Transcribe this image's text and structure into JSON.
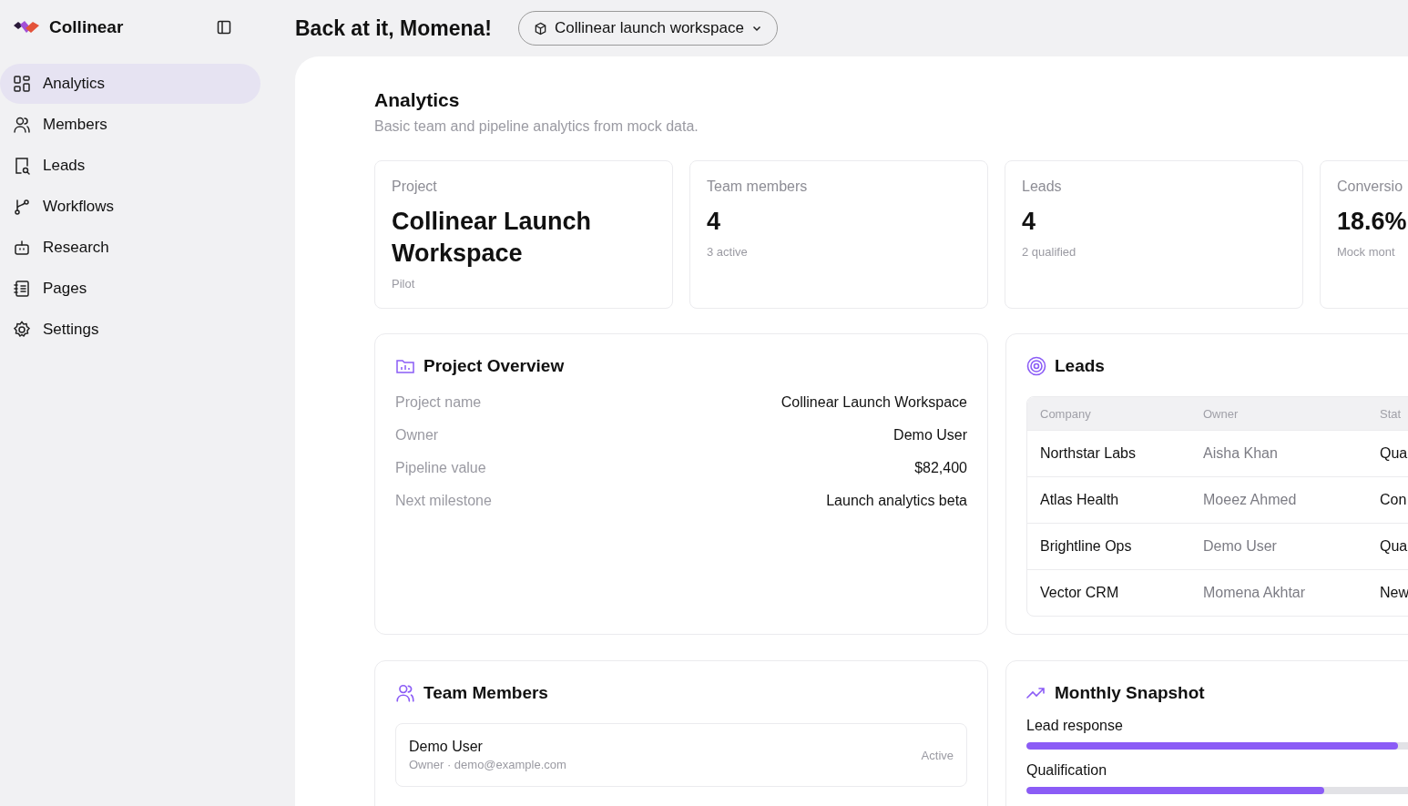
{
  "brand": {
    "name": "Collinear"
  },
  "sidebar": {
    "items": [
      {
        "label": "Analytics",
        "selected": true
      },
      {
        "label": "Members",
        "selected": false
      },
      {
        "label": "Leads",
        "selected": false
      },
      {
        "label": "Workflows",
        "selected": false
      },
      {
        "label": "Research",
        "selected": false
      },
      {
        "label": "Pages",
        "selected": false
      },
      {
        "label": "Settings",
        "selected": false
      }
    ]
  },
  "header": {
    "greeting": "Back at it, Momena!",
    "workspace": "Collinear launch workspace"
  },
  "page": {
    "title": "Analytics",
    "subtitle": "Basic team and pipeline analytics from mock data."
  },
  "stats": [
    {
      "label": "Project",
      "value": "Collinear Launch Workspace",
      "note": "Pilot"
    },
    {
      "label": "Team members",
      "value": "4",
      "note": "3 active"
    },
    {
      "label": "Leads",
      "value": "4",
      "note": "2 qualified"
    },
    {
      "label": "Conversio",
      "value": "18.6%",
      "note": "Mock mont"
    }
  ],
  "project_overview": {
    "title": "Project Overview",
    "fields": [
      {
        "label": "Project name",
        "value": "Collinear Launch Workspace"
      },
      {
        "label": "Owner",
        "value": "Demo User"
      },
      {
        "label": "Pipeline value",
        "value": "$82,400"
      },
      {
        "label": "Next milestone",
        "value": "Launch analytics beta"
      }
    ]
  },
  "leads": {
    "title": "Leads",
    "columns": [
      "Company",
      "Owner",
      "Stat"
    ],
    "rows": [
      [
        "Northstar Labs",
        "Aisha Khan",
        "Qua"
      ],
      [
        "Atlas Health",
        "Moeez Ahmed",
        "Con"
      ],
      [
        "Brightline Ops",
        "Demo User",
        "Qua"
      ],
      [
        "Vector CRM",
        "Momena Akhtar",
        "New"
      ]
    ]
  },
  "team_members": {
    "title": "Team Members",
    "members": [
      {
        "name": "Demo User",
        "detail": "Owner · demo@example.com",
        "status": "Active"
      }
    ]
  },
  "monthly_snapshot": {
    "title": "Monthly Snapshot",
    "metrics": [
      {
        "label": "Lead response",
        "level": 0.65
      },
      {
        "label": "Qualification",
        "level": 0.52
      }
    ]
  }
}
